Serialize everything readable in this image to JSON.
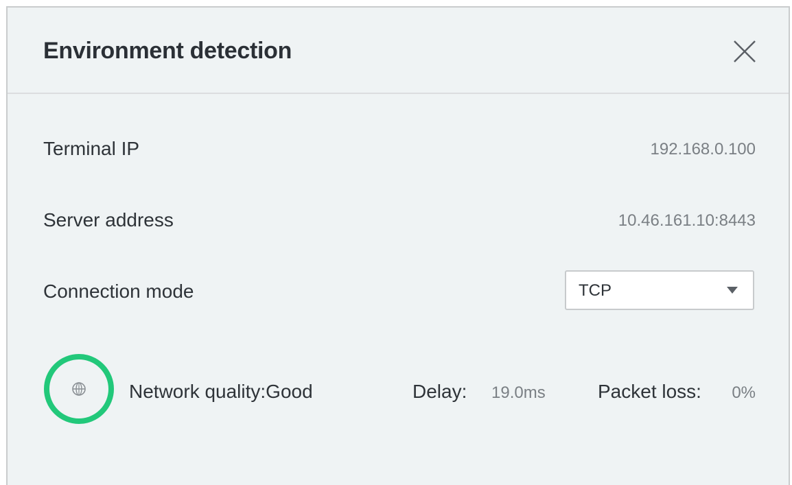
{
  "dialog": {
    "title": "Environment detection",
    "close_icon": "close-icon"
  },
  "rows": {
    "terminal_ip": {
      "label": "Terminal IP",
      "value": "192.168.0.100"
    },
    "server_address": {
      "label": "Server address",
      "value": "10.46.161.10:8443"
    },
    "connection_mode": {
      "label": "Connection mode",
      "selected": "TCP",
      "icon": "chevron-down-icon"
    }
  },
  "network": {
    "quality_text": "Network quality:Good",
    "status_color": "#22c87a",
    "icon": "globe-icon",
    "delay_label": "Delay:",
    "delay_value": "19.0ms",
    "loss_label": "Packet loss:",
    "loss_value": "0%"
  }
}
